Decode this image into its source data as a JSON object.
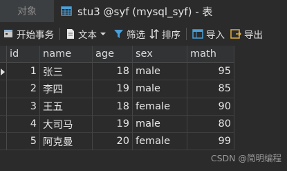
{
  "tabs": {
    "inactive": "对象",
    "active": "stu3 @syf (mysql_syf) - 表"
  },
  "toolbar": {
    "begin_transaction": "开始事务",
    "text": "文本",
    "filter": "筛选",
    "sort": "排序",
    "import": "导入",
    "export": "导出"
  },
  "grid": {
    "columns": [
      "id",
      "name",
      "age",
      "sex",
      "math"
    ],
    "rows": [
      {
        "id": "1",
        "name": "张三",
        "age": "18",
        "sex": "male",
        "math": "95"
      },
      {
        "id": "2",
        "name": "李四",
        "age": "19",
        "sex": "male",
        "math": "85"
      },
      {
        "id": "3",
        "name": "王五",
        "age": "18",
        "sex": "female",
        "math": "90"
      },
      {
        "id": "4",
        "name": "大司马",
        "age": "19",
        "sex": "male",
        "math": "80"
      },
      {
        "id": "5",
        "name": "阿克曼",
        "age": "20",
        "sex": "female",
        "math": "99"
      }
    ]
  },
  "watermark": "CSDN @简明编程",
  "colors": {
    "background": "#2b2b2b",
    "tabbar": "#3c3f41",
    "table_icon": "#4a9fd8",
    "import_icon": "#4a9fd8"
  }
}
